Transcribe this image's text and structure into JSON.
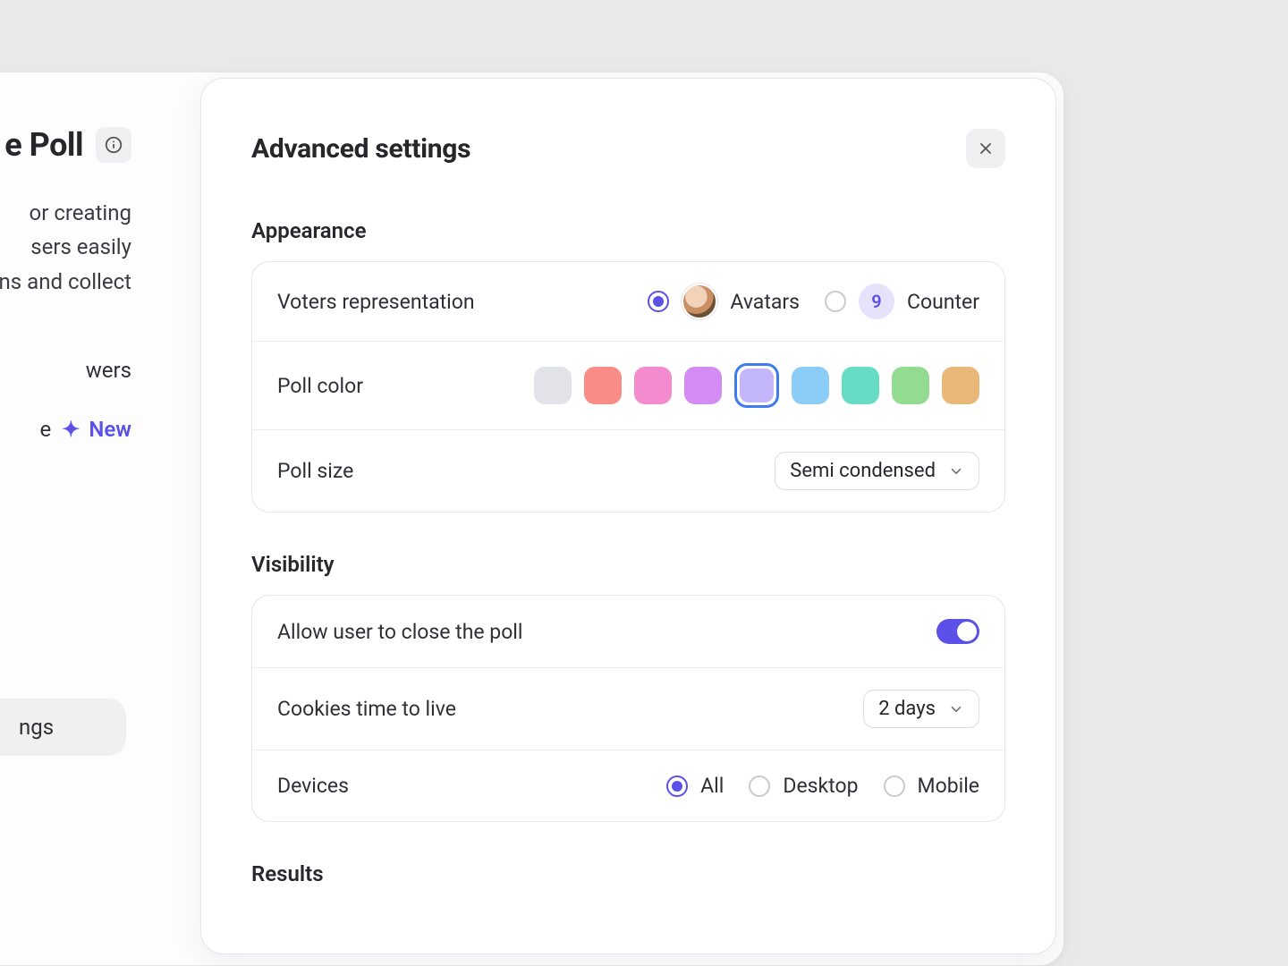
{
  "left": {
    "title_suffix": "e Poll",
    "desc_line1": "or creating",
    "desc_line2": "sers easily",
    "desc_line3": "ns and collect",
    "link1": "wers",
    "link2_prefix": "e",
    "new_label": "New",
    "pill_suffix": "ngs"
  },
  "modal": {
    "title": "Advanced settings",
    "sections": {
      "appearance": {
        "title": "Appearance",
        "voters_label": "Voters representation",
        "option_avatars": "Avatars",
        "option_counter": "Counter",
        "counter_value": "9",
        "poll_color_label": "Poll color",
        "colors": {
          "c0": "#e2e2e9",
          "c1": "#f98c86",
          "c2": "#f58bcf",
          "c3": "#d48cf4",
          "c4": "#c3b6fb",
          "c5": "#8ccdf7",
          "c6": "#67dcc4",
          "c7": "#93db91",
          "c8": "#e9b878"
        },
        "poll_size_label": "Poll size",
        "poll_size_value": "Semi condensed"
      },
      "visibility": {
        "title": "Visibility",
        "allow_close_label": "Allow user to close the poll",
        "cookies_label": "Cookies time to live",
        "cookies_value": "2 days",
        "devices_label": "Devices",
        "device_all": "All",
        "device_desktop": "Desktop",
        "device_mobile": "Mobile"
      },
      "results": {
        "title": "Results"
      }
    }
  }
}
